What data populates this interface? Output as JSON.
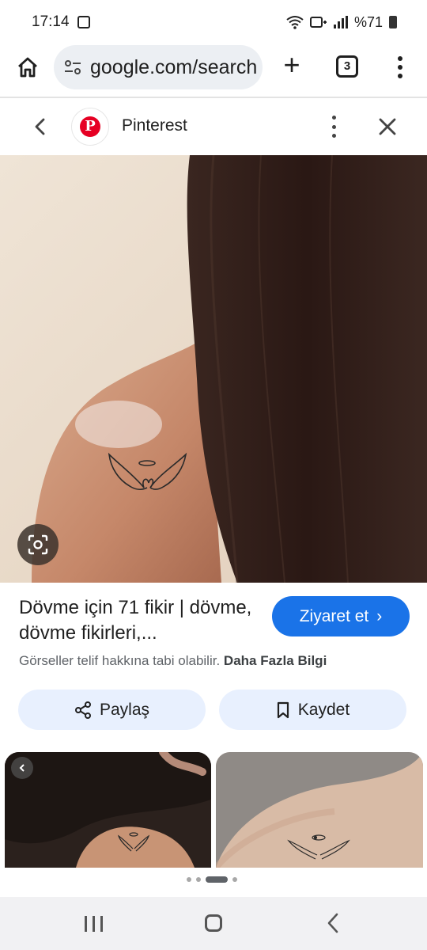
{
  "status_bar": {
    "time": "17:14",
    "battery_text": "%71"
  },
  "browser": {
    "url": "google.com/search",
    "tab_count": "3"
  },
  "source": {
    "name": "Pinterest",
    "logo_letter": "P",
    "brand_color": "#e60023"
  },
  "result": {
    "title": "Dövme için 71 fikir | dövme, dövme fikirleri,...",
    "visit_label": "Ziyaret et",
    "visit_chevron": "›",
    "copyright_text": "Görseller telif hakkına tabi olabilir.",
    "learn_more": "Daha Fazla Bilgi"
  },
  "actions": {
    "share_label": "Paylaş",
    "save_label": "Kaydet"
  },
  "pager": {
    "pages": 4,
    "active_page": 3
  },
  "colors": {
    "accent": "#1a73e8",
    "pill_bg": "#e8f0fe",
    "omnibox_bg": "#eceff3"
  }
}
